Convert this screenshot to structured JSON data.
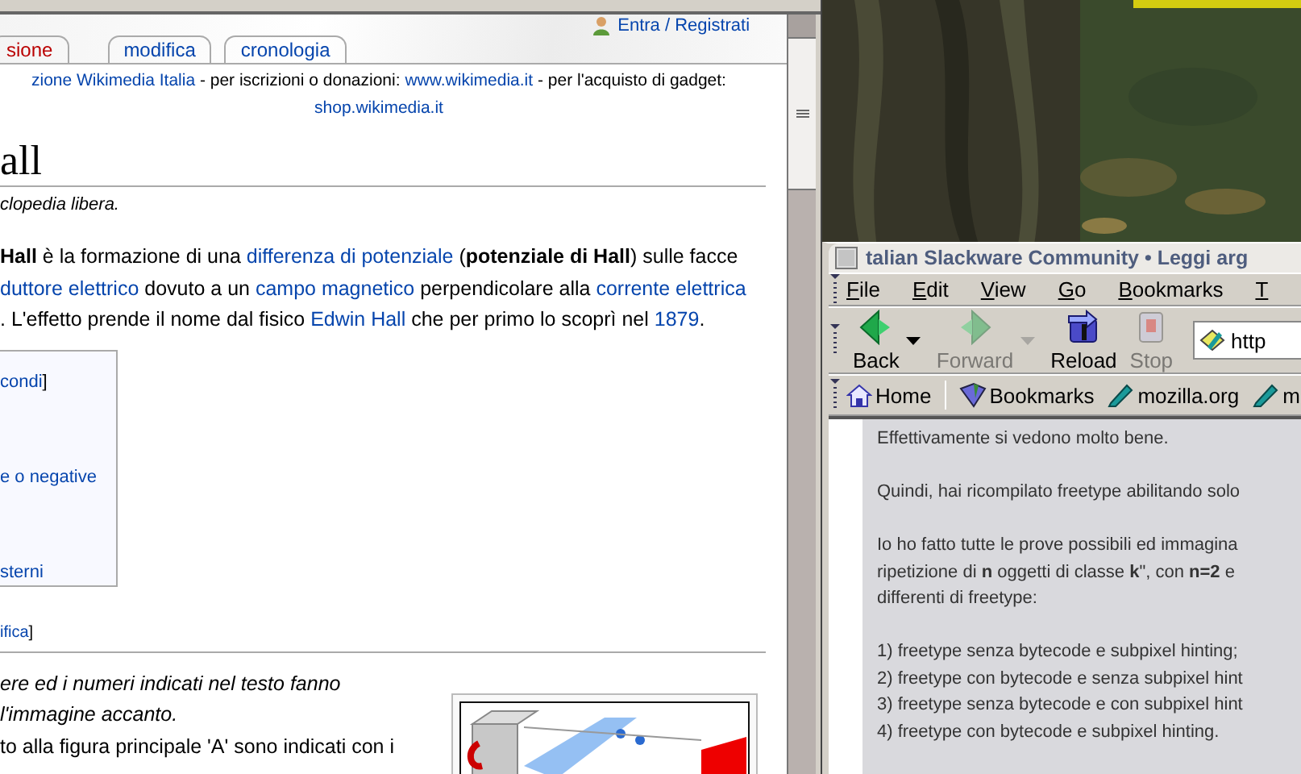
{
  "left_window": {
    "user_link": "Entra / Registrati",
    "tabs": [
      {
        "label": "sione",
        "selected": false,
        "missing": true
      },
      {
        "label": "modifica",
        "selected": false,
        "missing": false
      },
      {
        "label": "cronologia",
        "selected": false,
        "missing": false
      }
    ],
    "notice": [
      [
        {
          "kind": "link",
          "text": "zione Wikimedia Italia"
        },
        {
          "kind": "text",
          "text": " - per iscrizioni o donazioni: "
        },
        {
          "kind": "link",
          "text": "www.wikimedia.it"
        },
        {
          "kind": "text",
          "text": " - per l'acquisto di gadget:"
        }
      ],
      [
        {
          "kind": "link",
          "text": "shop.wikimedia.it"
        }
      ]
    ],
    "title": "all",
    "tagline": "clopedia libera.",
    "intro": [
      [
        {
          "kind": "text",
          "text": "**Hall** è la formazione di una "
        },
        {
          "kind": "link",
          "text": "differenza di potenziale"
        },
        {
          "kind": "text",
          "text": " (**potenziale di Hall**) sulle facce"
        }
      ],
      [
        {
          "kind": "link",
          "text": "duttore elettrico"
        },
        {
          "kind": "text",
          "text": " dovuto a un "
        },
        {
          "kind": "link",
          "text": "campo magnetico"
        },
        {
          "kind": "text",
          "text": " perpendicolare alla "
        },
        {
          "kind": "link",
          "text": "corrente elettrica"
        }
      ],
      [
        {
          "kind": "text",
          "text": ". L'effetto prende il nome dal fisico "
        },
        {
          "kind": "link",
          "text": "Edwin Hall"
        },
        {
          "kind": "text",
          "text": " che per primo lo scoprì nel "
        },
        {
          "kind": "link",
          "text": "1879"
        },
        {
          "kind": "text",
          "text": "."
        }
      ]
    ],
    "toc": [
      [
        {
          "kind": "link",
          "text": "condi"
        },
        {
          "kind": "text",
          "text": "]"
        }
      ],
      [
        {
          "kind": "link",
          "text": "e o negative"
        }
      ],
      [
        {
          "kind": "link",
          "text": "sterni"
        }
      ]
    ],
    "section_edit": [
      {
        "kind": "link",
        "text": "ifica"
      },
      {
        "kind": "text",
        "text": "]"
      }
    ],
    "note": [
      "ere ed i numeri indicati nel testo fanno",
      "l'immagine accanto."
    ],
    "partial_line": "to alla figura principale 'A' sono indicati con i"
  },
  "right_window": {
    "title": "talian Slackware Community • Leggi arg",
    "menu": [
      "File",
      "Edit",
      "View",
      "Go",
      "Bookmarks",
      "T"
    ],
    "toolbar": [
      {
        "label": "Back",
        "kind": "back",
        "disabled": false,
        "has_menu": true
      },
      {
        "label": "Forward",
        "kind": "forward",
        "disabled": true,
        "has_menu": true
      },
      {
        "label": "Reload",
        "kind": "reload",
        "disabled": false,
        "has_menu": false
      },
      {
        "label": "Stop",
        "kind": "stop",
        "disabled": true,
        "has_menu": false
      }
    ],
    "url": "http",
    "bookmarks": [
      {
        "label": "Home",
        "kind": "home"
      },
      {
        "label": "Bookmarks",
        "kind": "folder"
      },
      {
        "label": "mozilla.org",
        "kind": "link"
      },
      {
        "label": "m",
        "kind": "link"
      }
    ],
    "post": [
      [
        "Effettivamente si vedono molto bene."
      ],
      [
        "Quindi, hai ricompilato freetype abilitando solo"
      ],
      [
        "Io ho fatto tutte le prove possibili ed immagina",
        "ripetizione di **n** oggetti di classe **k**\", con **n=2** e",
        "differenti di freetype:"
      ],
      [
        "1) freetype senza bytecode e subpixel hinting;",
        "2) freetype con bytecode e senza subpixel hint",
        "3) freetype senza bytecode e con subpixel hint",
        "4) freetype con bytecode e subpixel hinting."
      ]
    ]
  }
}
